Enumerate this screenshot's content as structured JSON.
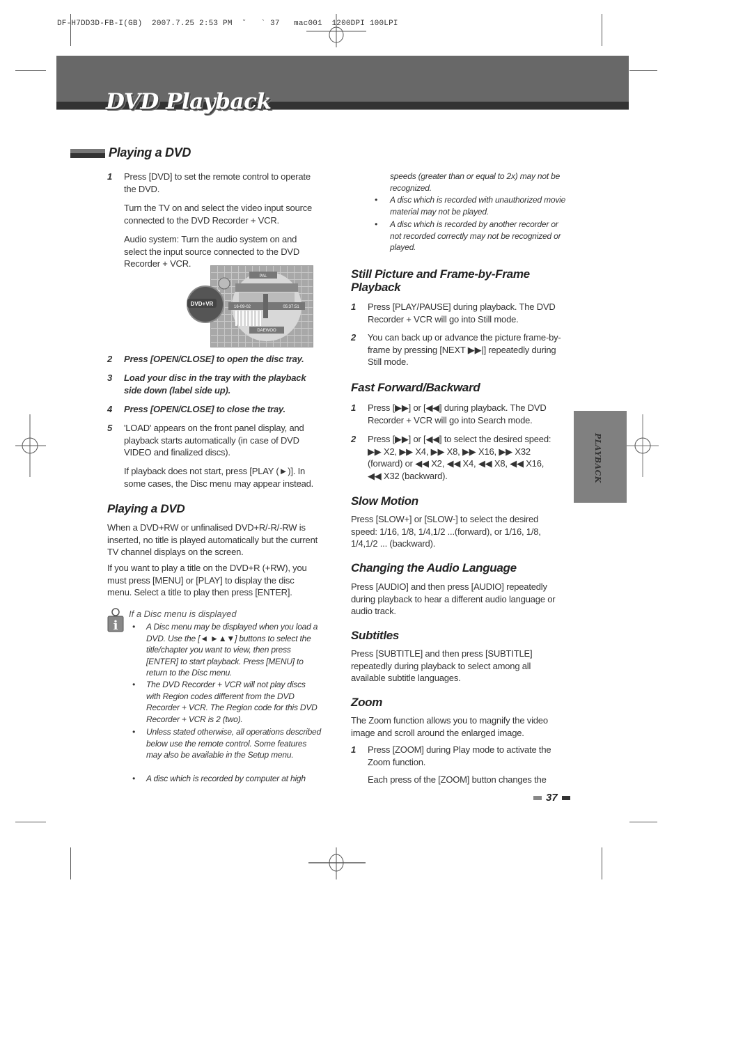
{
  "slug_line": "DF-H7DD3D-FB-I(GB)  2007.7.25 2:53 PM  ˘   ` 37   mac001  1200DPI 100LPI",
  "header": {
    "title": "DVD Playback"
  },
  "side_tab": {
    "label": "PLAYBACK"
  },
  "page_number": "37",
  "colors": {
    "banner": "#686868",
    "band": "#333333",
    "side_tab": "#808080"
  },
  "left_column": {
    "section1": {
      "title": "Playing a DVD",
      "steps": [
        {
          "num": "1",
          "text": "Press [DVD] to set the remote control to operate the DVD."
        },
        {
          "num": "",
          "text": "Turn the TV on and select the video input source connected to the DVD Recorder + VCR."
        },
        {
          "num": "",
          "text": "Audio system: Turn the audio system on and select the input source connected to the DVD Recorder + VCR."
        },
        {
          "num": "2",
          "text": "Press [OPEN/CLOSE] to open the disc tray."
        },
        {
          "num": "3",
          "text": "Load your disc in the tray with the playback side down (label side up)."
        },
        {
          "num": "4",
          "text": "Press [OPEN/CLOSE] to close the tray."
        },
        {
          "num": "5",
          "text": "'LOAD' appears on the front panel display, and playback starts automatically (in case of DVD VIDEO and finalized discs)."
        },
        {
          "num": "",
          "text": "If playback does not start, press [PLAY (►)]. In some cases, the Disc menu may appear instead."
        }
      ],
      "image": {
        "badge": "DVD+VR",
        "top_label": "PAL",
        "date": "16-09-02",
        "time": "05:37:51",
        "brand": "DAEWOO"
      }
    },
    "section2": {
      "title": "Playing a DVD",
      "paragraphs": [
        "When a DVD+RW or unfinalised DVD+R/-R/-RW is inserted, no title is played automatically but the current TV channel displays on the screen.",
        "If you want to play a title on the DVD+R (+RW), you must press [MENU] or [PLAY] to display the disc menu. Select a title to play then press [ENTER]."
      ]
    },
    "note": {
      "title": "If a Disc menu is displayed",
      "bullets": [
        "A Disc menu may be displayed when you load a DVD. Use the [◄ ►▲▼] buttons to select the title/chapter you want to view, then press [ENTER] to start playback. Press [MENU] to return to the Disc menu.",
        "The DVD Recorder + VCR will not play discs with Region codes different from the DVD Recorder + VCR. The Region code for this DVD Recorder + VCR is 2 (two).",
        "Unless stated otherwise, all operations described below use the remote control. Some features may also be available in the Setup menu.",
        "A disc which is recorded by computer at high"
      ]
    }
  },
  "right_column": {
    "note_continued": {
      "lead": "speeds (greater than or equal to 2x) may not be recognized.",
      "bullets": [
        "A disc which is recorded with unauthorized movie material may not be played.",
        "A disc which is recorded by another recorder or not recorded correctly may not be recognized or played."
      ]
    },
    "still": {
      "title": "Still Picture and Frame-by-Frame Playback",
      "steps": [
        {
          "num": "1",
          "text": "Press [PLAY/PAUSE] during playback. The DVD Recorder + VCR will go into Still mode."
        },
        {
          "num": "2",
          "text": "You can back up or advance the picture frame-by-frame by pressing [NEXT ▶▶|] repeatedly during Still mode."
        }
      ]
    },
    "fast": {
      "title": "Fast Forward/Backward",
      "steps": [
        {
          "num": "1",
          "text": "Press [▶▶] or [◀◀] during playback. The DVD Recorder + VCR will go into Search mode."
        },
        {
          "num": "2",
          "text": "Press [▶▶] or [◀◀] to select the desired speed: ▶▶ X2, ▶▶ X4, ▶▶ X8, ▶▶ X16, ▶▶ X32 (forward) or ◀◀ X2, ◀◀ X4, ◀◀ X8, ◀◀ X16, ◀◀ X32 (backward)."
        }
      ]
    },
    "slow": {
      "title": "Slow Motion",
      "text": "Press [SLOW+] or [SLOW-] to select the desired speed: 1/16, 1/8, 1/4,1/2 ...(forward), or 1/16, 1/8, 1/4,1/2 ... (backward)."
    },
    "audio": {
      "title": "Changing the Audio Language",
      "text": "Press [AUDIO] and then press [AUDIO] repeatedly during playback to hear a different audio language or audio track."
    },
    "subtitles": {
      "title": "Subtitles",
      "text": "Press [SUBTITLE] and then press [SUBTITLE] repeatedly during playback to select among all available subtitle languages."
    },
    "zoom": {
      "title": "Zoom",
      "text": "The Zoom function allows you to magnify the video image and scroll around the enlarged image.",
      "steps": [
        {
          "num": "1",
          "text": "Press [ZOOM] during Play mode to activate the Zoom function."
        },
        {
          "num": "",
          "text": "Each press of the [ZOOM] button changes the"
        }
      ]
    }
  }
}
